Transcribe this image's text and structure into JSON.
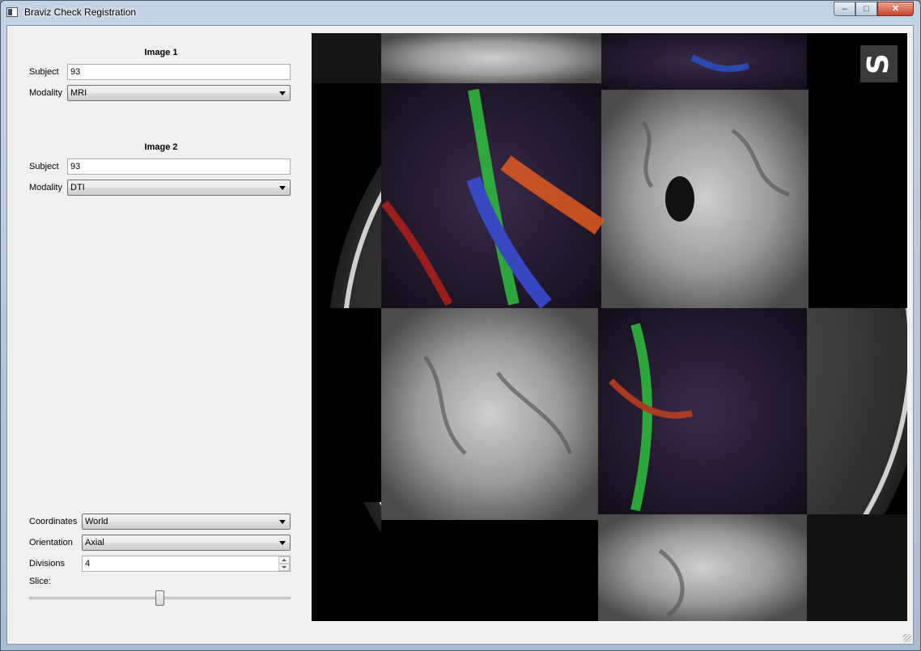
{
  "window": {
    "title": "Braviz Check Registration",
    "controls": {
      "minimize": "–",
      "maximize": "□",
      "close": "✕"
    }
  },
  "image1": {
    "header": "Image 1",
    "subject_label": "Subject",
    "subject_value": "93",
    "modality_label": "Modality",
    "modality_value": "MRI"
  },
  "image2": {
    "header": "Image 2",
    "subject_label": "Subject",
    "subject_value": "93",
    "modality_label": "Modality",
    "modality_value": "DTI"
  },
  "settings": {
    "coordinates_label": "Coordinates",
    "coordinates_value": "World",
    "orientation_label": "Orientation",
    "orientation_value": "Axial",
    "divisions_label": "Divisions",
    "divisions_value": "4",
    "slice_label": "Slice:",
    "slice_position": 0.5
  },
  "viewer": {
    "logo_text": "S",
    "checkerboard_divisions": 4
  },
  "colors": {
    "client_bg": "#f0f0f0",
    "viewer_bg": "#000000",
    "titlebar": "#b8cadc"
  }
}
